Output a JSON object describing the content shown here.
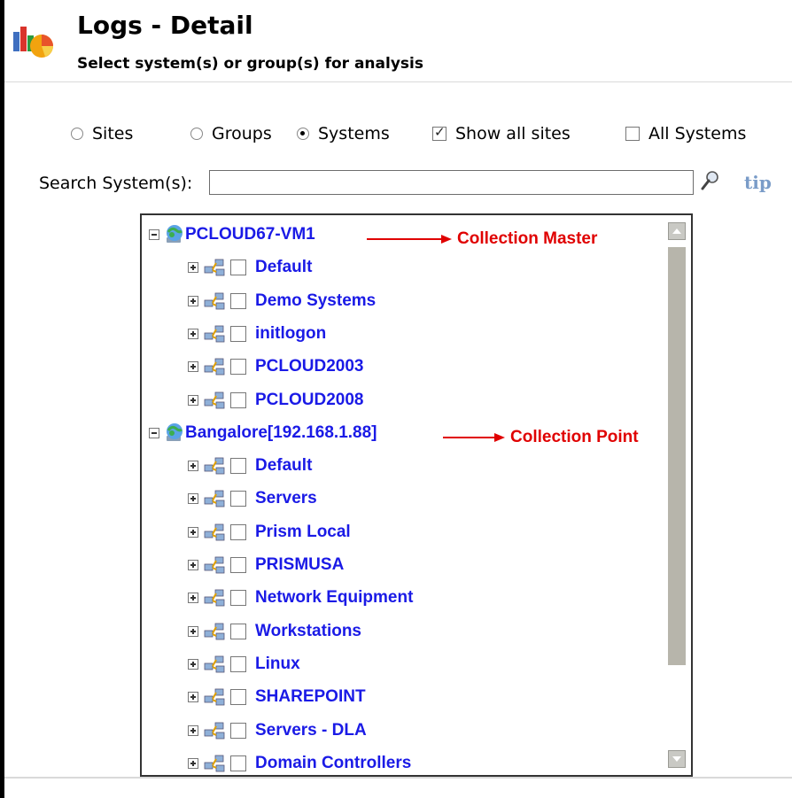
{
  "header": {
    "title": "Logs - Detail",
    "subtitle": "Select system(s) or group(s) for analysis"
  },
  "options": {
    "sites_label": "Sites",
    "groups_label": "Groups",
    "systems_label": "Systems",
    "show_all_sites_label": "Show all sites",
    "all_systems_label": "All Systems",
    "selected": "Systems",
    "show_all_sites_checked": true,
    "all_systems_checked": false
  },
  "search": {
    "label": "Search System(s):",
    "value": "",
    "tip": "tip"
  },
  "tree": {
    "sites": [
      {
        "name": "PCLOUD67-VM1",
        "annotation": "Collection Master",
        "groups": [
          "Default",
          "Demo Systems",
          "initlogon",
          "PCLOUD2003",
          "PCLOUD2008"
        ]
      },
      {
        "name": "Bangalore[192.168.1.88]",
        "annotation": "Collection Point",
        "groups": [
          "Default",
          "Servers",
          "Prism Local",
          "PRISMUSA",
          "Network Equipment",
          "Workstations",
          "Linux",
          "SHAREPOINT",
          "Servers - DLA",
          "Domain Controllers"
        ]
      }
    ]
  },
  "colors": {
    "link_blue": "#1a1ae6",
    "annotation_red": "#e00000",
    "tip_blue": "#7a9cc8",
    "scroll_thumb": "#b7b5ab"
  }
}
